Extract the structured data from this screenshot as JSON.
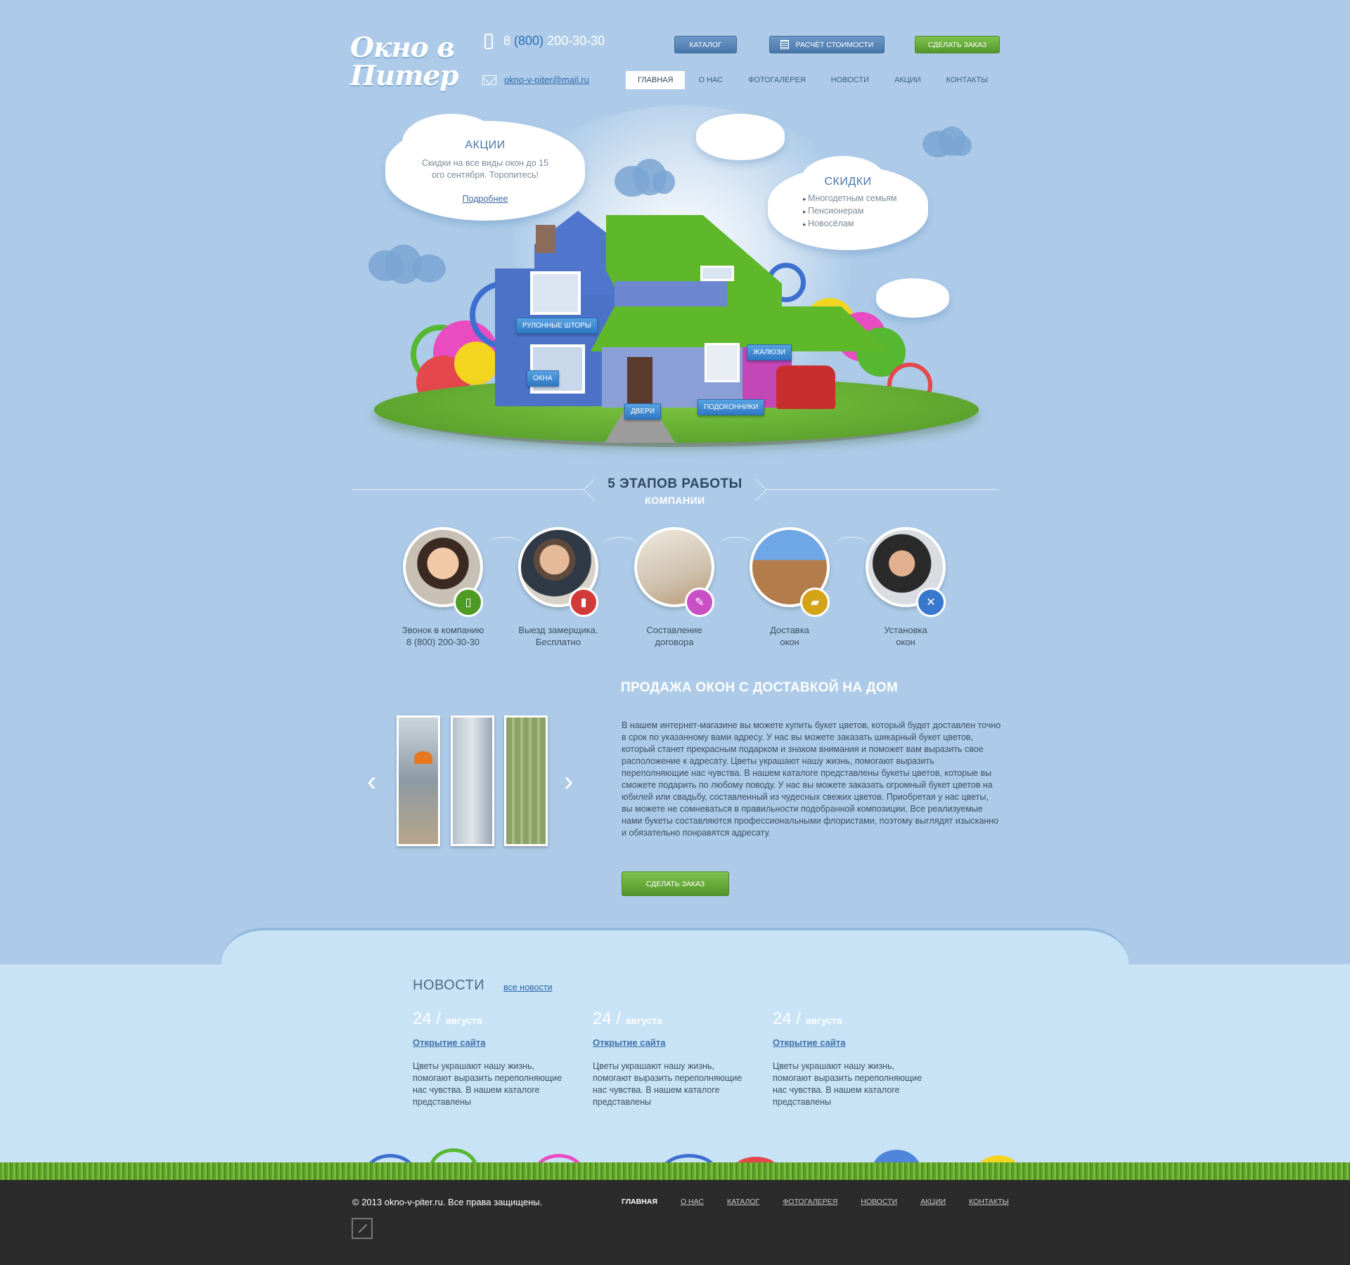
{
  "header": {
    "logo_line1": "Окно в",
    "logo_line2": "Питер",
    "phone_prefix": "8",
    "phone_code": "(800)",
    "phone_number": "200-30-30",
    "email": "okno-v-piter@mail.ru",
    "catalog_label": "КАТАЛОГ",
    "calc_label": "РАСЧЁТ СТОИМОСТИ",
    "order_label": "СДЕЛАТЬ ЗАКАЗ"
  },
  "nav": [
    "ГЛАВНАЯ",
    "О НАС",
    "ФОТОГАЛЕРЕЯ",
    "НОВОСТИ",
    "АКЦИИ",
    "КОНТАКТЫ"
  ],
  "promo": {
    "title": "АКЦИИ",
    "text_line1": "Скидки на все виды окон до 15",
    "text_line2": "ого сентября. Торопитесь!",
    "link": "Подробнее"
  },
  "discounts": {
    "title": "СКИДКИ",
    "items": [
      "Многодетным семьям",
      "Пенсионерам",
      "Новосёлам"
    ]
  },
  "hero_labels": {
    "blinds": "РУЛОННЫЕ ШТОРЫ",
    "windows": "ОКНА",
    "doors": "ДВЕРИ",
    "sills": "ПОДОКОННИКИ",
    "jalousie": "ЖАЛЮЗИ"
  },
  "stages": {
    "title": "5 ЭТАПОВ РАБОТЫ",
    "subtitle": "КОМПАНИИ",
    "steps": [
      {
        "line1": "Звонок в компанию",
        "line2": "8 (800) 200-30-30",
        "icon": "phone-icon",
        "color": "#4f9a23"
      },
      {
        "line1": "Выезд замерщика.",
        "line2": "Бесплатно",
        "icon": "ruler-icon",
        "color": "#d23a3a"
      },
      {
        "line1": "Составление",
        "line2": "договора",
        "icon": "pen-icon",
        "color": "#c94fc6"
      },
      {
        "line1": "Доставка",
        "line2": "окон",
        "icon": "truck-icon",
        "color": "#d4a418"
      },
      {
        "line1": "Установка",
        "line2": "окон",
        "icon": "tools-icon",
        "color": "#3978cf"
      }
    ]
  },
  "sale": {
    "title": "ПРОДАЖА ОКОН С ДОСТАВКОЙ НА ДОМ",
    "text": "В нашем интернет-магазине вы можете купить букет цветов, который будет доставлен точно в срок по указанному вами адресу. У нас вы можете заказать шикарный букет цветов, который станет прекрасным подарком и знаком внимания и поможет вам выразить свое расположение к адресату. Цветы украшают нашу жизнь, помогают выразить переполняющие нас чувства. В нашем каталоге представлены букеты цветов, которые вы сможете подарить по любому поводу. У нас вы можете заказать огромный букет цветов на юбилей или свадьбу, составленный из чудесных свежих цветов. Приобретая у нас цветы, вы можете не сомневаться в правильности подобранной композиции. Все реализуемые нами букеты составляются профессиональными флористами, поэтому выглядят изысканно и обязательно понравятся адресату.",
    "order_label": "СДЕЛАТЬ ЗАКАЗ",
    "prev": "‹",
    "next": "›"
  },
  "news": {
    "title": "НОВОСТИ",
    "all_link": "все новости",
    "items": [
      {
        "day": "24",
        "sep": "/",
        "month": "августа",
        "title": "Открытие сайта",
        "text": "Цветы украшают нашу жизнь, помогают выразить переполняющие нас чувства. В нашем каталоге представлены"
      },
      {
        "day": "24",
        "sep": "/",
        "month": "августа",
        "title": "Открытие сайта",
        "text": "Цветы украшают нашу жизнь, помогают выразить переполняющие нас чувства. В нашем каталоге представлены"
      },
      {
        "day": "24",
        "sep": "/",
        "month": "августа",
        "title": "Открытие сайта",
        "text": "Цветы украшают нашу жизнь, помогают выразить переполняющие нас чувства. В нашем каталоге представлены"
      }
    ]
  },
  "footer": {
    "copyright": "© 2013 okno-v-piter.ru. Все права защищены.",
    "nav": [
      "ГЛАВНАЯ",
      "О НАС",
      "КАТАЛОГ",
      "ФОТОГАЛЕРЕЯ",
      "НОВОСТИ",
      "АКЦИИ",
      "КОНТАКТЫ"
    ]
  }
}
